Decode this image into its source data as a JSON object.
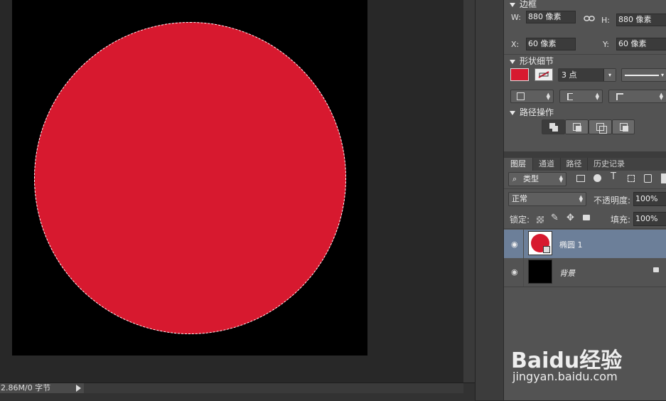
{
  "canvas": {
    "fill_color": "#d7192f",
    "doc_background": "#000000"
  },
  "status_bar": {
    "doc_size": "2.86M/0 字节"
  },
  "properties": {
    "border_section": "边框",
    "w_label": "W:",
    "w_value": "880 像素",
    "h_label": "H:",
    "h_value": "880 像素",
    "x_label": "X:",
    "x_value": "60 像素",
    "y_label": "Y:",
    "y_value": "60 像素",
    "shape_details_section": "形状细节",
    "fill_swatch_color": "#d7192f",
    "stroke_width": "3 点",
    "path_ops_section": "路径操作"
  },
  "layers_panel": {
    "tabs": [
      "图层",
      "通道",
      "路径",
      "历史记录"
    ],
    "active_tab": "图层",
    "filter_kind": "类型",
    "blend_mode": "正常",
    "opacity_label": "不透明度:",
    "opacity_value": "100%",
    "lock_label": "锁定:",
    "fill_label": "填充:",
    "fill_value": "100%",
    "layers": [
      {
        "name": "椭圆 1",
        "selected": true
      },
      {
        "name": "背景",
        "selected": false,
        "locked": true
      }
    ]
  },
  "watermark": {
    "brand": "Baidu经验",
    "url": "jingyan.baidu.com"
  }
}
